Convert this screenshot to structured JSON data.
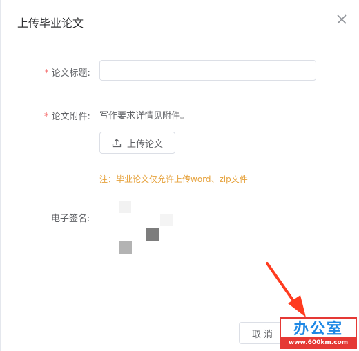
{
  "dialog": {
    "title": "上传毕业论文",
    "close_icon": "close-icon"
  },
  "form": {
    "title_field": {
      "required_mark": "*",
      "label": "论文标题:",
      "value": "",
      "placeholder": ""
    },
    "attachment_field": {
      "required_mark": "*",
      "label": "论文附件:",
      "hint": "写作要求详情见附件。",
      "upload_button_label": "上传论文",
      "upload_icon": "upload-icon",
      "note": "注：毕业论文仅允许上传word、zip文件"
    },
    "signature_field": {
      "label": "电子签名:"
    }
  },
  "footer": {
    "cancel_label": "取 消"
  },
  "watermark": {
    "top_text": "办公室",
    "url_text": "www.600km.com"
  },
  "colors": {
    "required": "#f56c6c",
    "note": "#e6a23c",
    "annotation_arrow": "#ff3b1f",
    "watermark_border": "#e53935"
  }
}
